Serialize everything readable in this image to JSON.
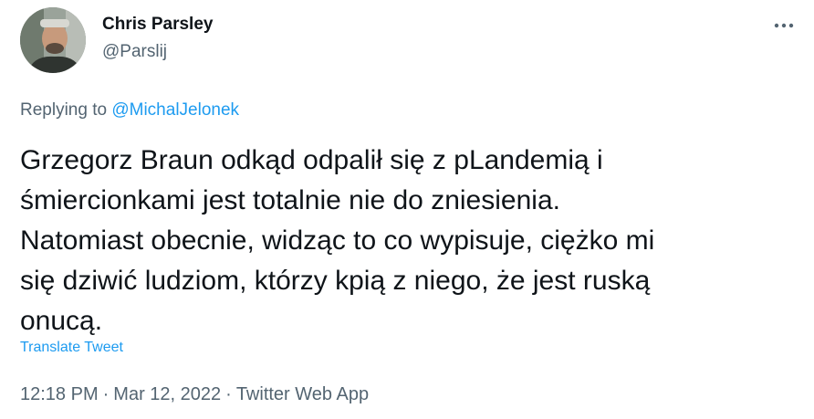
{
  "author": {
    "name": "Chris Parsley",
    "handle": "@Parslij"
  },
  "more_icon": "more-horizontal-icon",
  "reply": {
    "prefix": "Replying to",
    "target": "@MichalJelonek"
  },
  "text": "Grzegorz Braun odkąd odpalił się z pLandemią i\nśmiercionkami jest totalnie nie do zniesienia.\nNatomiast obecnie, widząc to co wypisuje, ciężko mi\nsię dziwić ludziom, którzy kpią z niego, że jest ruską\nonucą.",
  "translate_label": "Translate Tweet",
  "meta": {
    "time": "12:18 PM",
    "separator": "·",
    "date": "Mar 12, 2022",
    "source": "Twitter Web App"
  },
  "colors": {
    "link": "#1d9bf0",
    "secondary": "#536471",
    "text": "#0f1419"
  }
}
